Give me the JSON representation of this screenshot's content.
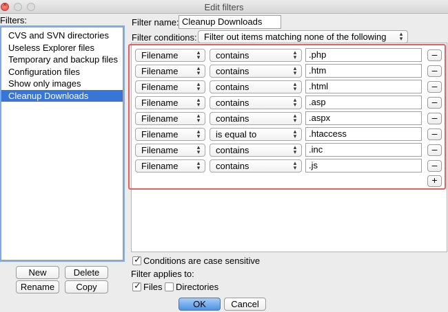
{
  "window": {
    "title": "Edit filters"
  },
  "filters_panel": {
    "label": "Filters:",
    "items": [
      "CVS and SVN directories",
      "Useless Explorer files",
      "Temporary and backup files",
      "Configuration files",
      "Show only images",
      "Cleanup Downloads"
    ],
    "selected_index": 5,
    "buttons": {
      "new": "New",
      "delete": "Delete",
      "rename": "Rename",
      "copy": "Copy"
    }
  },
  "filter_name": {
    "label": "Filter name:",
    "value": "Cleanup Downloads"
  },
  "filter_conditions": {
    "label": "Filter conditions:",
    "value": "Filter out items matching none of the following"
  },
  "conditions": [
    {
      "field": "Filename",
      "op": "contains",
      "value": ".php"
    },
    {
      "field": "Filename",
      "op": "contains",
      "value": ".htm"
    },
    {
      "field": "Filename",
      "op": "contains",
      "value": ".html"
    },
    {
      "field": "Filename",
      "op": "contains",
      "value": ".asp"
    },
    {
      "field": "Filename",
      "op": "contains",
      "value": ".aspx"
    },
    {
      "field": "Filename",
      "op": "is equal to",
      "value": ".htaccess"
    },
    {
      "field": "Filename",
      "op": "contains",
      "value": ".inc"
    },
    {
      "field": "Filename",
      "op": "contains",
      "value": ".js"
    }
  ],
  "remove_condition_label": "–",
  "add_condition_label": "+",
  "case_sensitive": {
    "label": "Conditions are case sensitive",
    "checked": true
  },
  "applies_to": {
    "label": "Filter applies to:",
    "files": {
      "label": "Files",
      "checked": true
    },
    "directories": {
      "label": "Directories",
      "checked": false
    }
  },
  "footer": {
    "ok": "OK",
    "cancel": "Cancel"
  },
  "colors": {
    "selection": "#3875d7",
    "highlight_border": "#e85d5d",
    "default_button": "#4c92e6"
  }
}
